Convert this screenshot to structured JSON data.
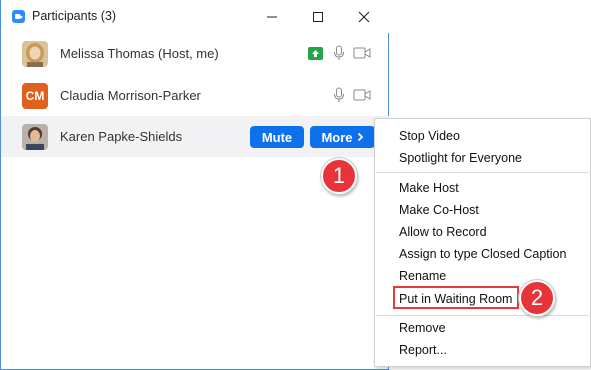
{
  "window": {
    "title": "Participants (3)"
  },
  "participants": [
    {
      "name": "Melissa Thomas (Host, me)",
      "initials": "",
      "sharing": true
    },
    {
      "name": "Claudia Morrison-Parker",
      "initials": "CM",
      "sharing": false
    },
    {
      "name": "Karen Papke-Shields",
      "initials": "",
      "sharing": false
    }
  ],
  "row_actions": {
    "mute_label": "Mute",
    "more_label": "More"
  },
  "context_menu": {
    "items": [
      "Stop Video",
      "Spotlight for Everyone",
      "Make Host",
      "Make Co-Host",
      "Allow to Record",
      "Assign to type Closed Caption",
      "Rename",
      "Put in Waiting Room",
      "Remove",
      "Report..."
    ]
  },
  "callouts": {
    "step1": "1",
    "step2": "2"
  },
  "colors": {
    "accent": "#0e71eb",
    "callout": "#e8333a",
    "share": "#23a34a",
    "initials_bg": "#e0611e"
  }
}
